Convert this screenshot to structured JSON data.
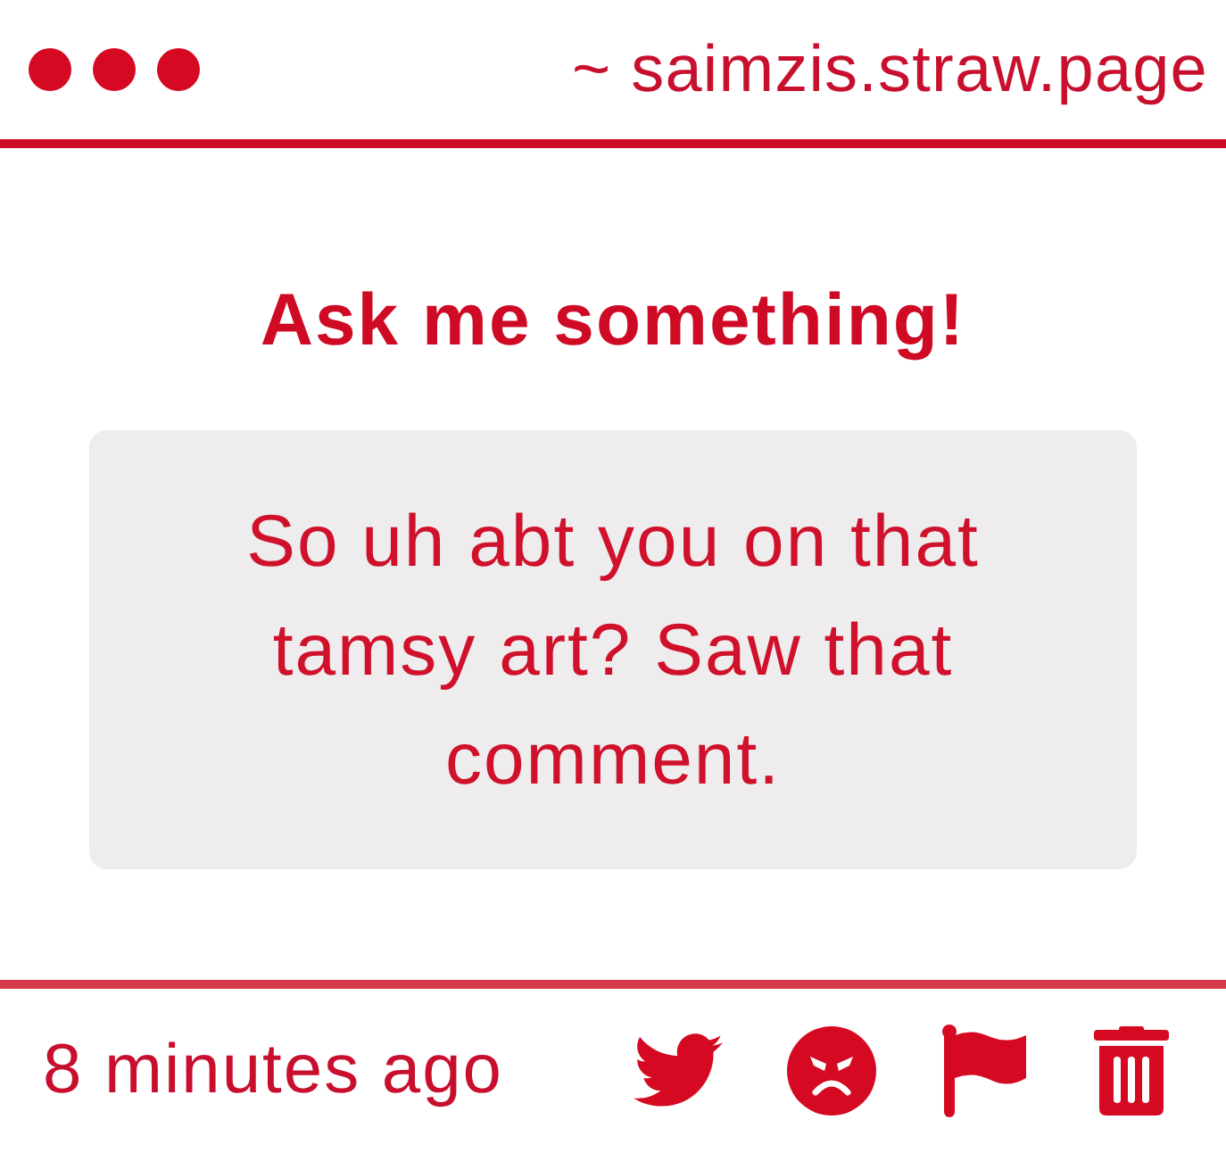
{
  "header": {
    "address": "~ saimzis.straw.page"
  },
  "prompt": {
    "title": "Ask me something!"
  },
  "question": {
    "text": "So uh abt you on that tamsy art? Saw that comment."
  },
  "footer": {
    "timestamp": "8 minutes ago"
  }
}
